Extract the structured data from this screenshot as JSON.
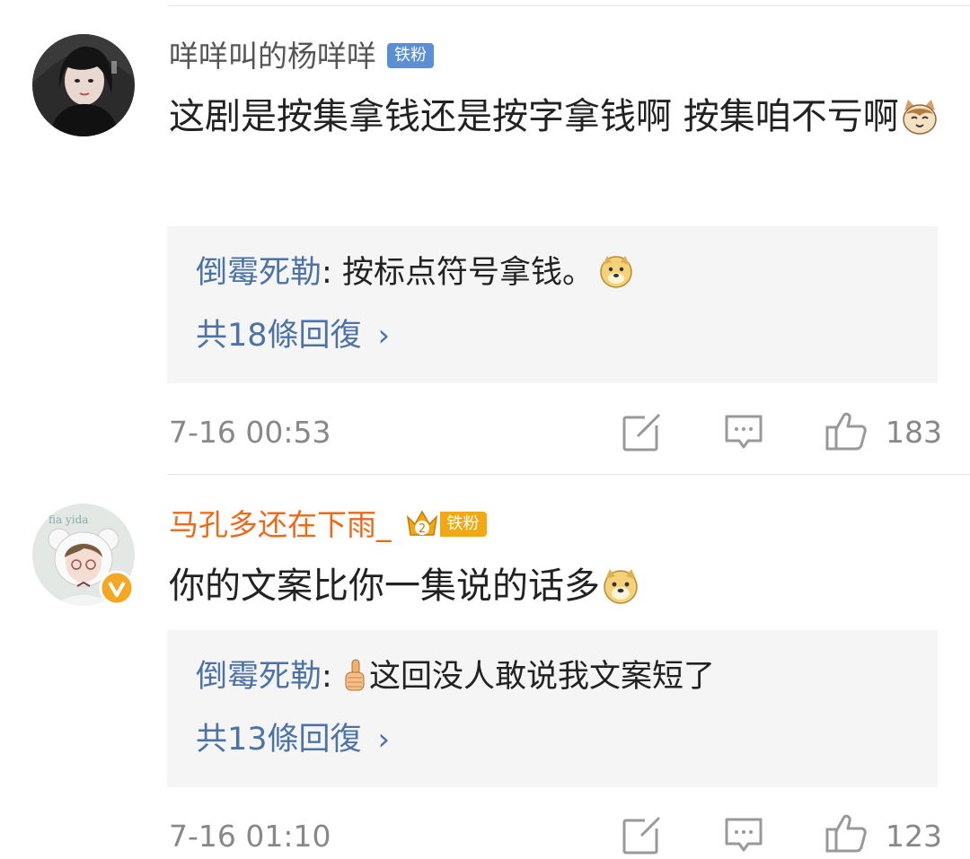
{
  "comments": [
    {
      "username": "咩咩叫的杨咩咩",
      "badge": "铁粉",
      "content": "这剧是按集拿钱还是按字拿钱啊 按集咱不亏啊",
      "content_emoji": "cat-emoji",
      "reply": {
        "author": "倒霉死勒",
        "separator": ": ",
        "text": "按标点符号拿钱。",
        "emoji": "doge-emoji"
      },
      "more_replies": "共18條回復",
      "timestamp": "7-16 00:53",
      "likes": "183"
    },
    {
      "username": "马孔多还在下雨_",
      "badge": "铁粉",
      "crown_level": "2",
      "content": "你的文案比你一集说的话多",
      "content_emoji": "doge-emoji",
      "reply": {
        "author": "倒霉死勒",
        "separator": ": ",
        "emoji": "thumbs-up-emoji",
        "text": "这回没人敢说我文案短了"
      },
      "more_replies": "共13條回復",
      "timestamp": "7-16 01:10",
      "likes": "123"
    }
  ],
  "colors": {
    "username_default": "#555555",
    "username_vip": "#e86a1a",
    "reply_author": "#4c73a3",
    "badge_blue": "#5a8fd8",
    "badge_gold": "#f2a814"
  }
}
